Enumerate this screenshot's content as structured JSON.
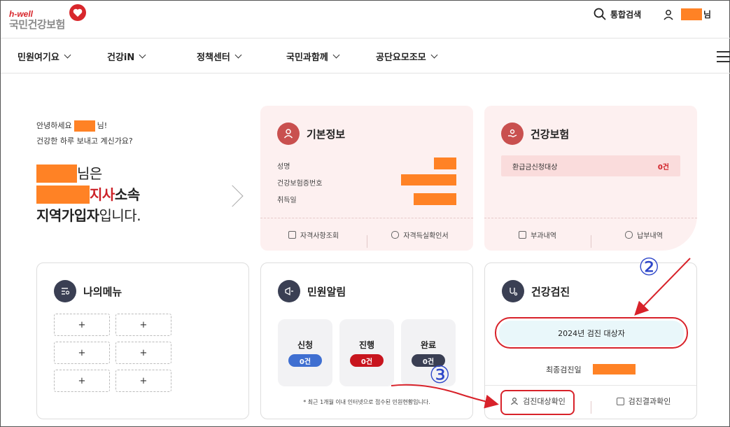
{
  "header": {
    "logo_top": "h-well",
    "logo_main": "국민건강보험",
    "search_label": "통합검색",
    "user_suffix": "님"
  },
  "nav": {
    "items": [
      "민원여기요",
      "건강iN",
      "정책센터",
      "국민과함께",
      "공단요모조모"
    ]
  },
  "greeting": {
    "line1_prefix": "안녕하세요",
    "line1_suffix": "님!",
    "line2": "건강한 하루 보내고 계신가요?",
    "big1_suffix": "님은",
    "big2_red": "지사",
    "big2_suffix": " 소속",
    "big3_bold": "지역가입자",
    "big3_suffix": "입니다."
  },
  "basic_info": {
    "title": "기본정보",
    "rows": [
      "성명",
      "건강보험증번호",
      "취득일"
    ],
    "foot_left": "자격사항조회",
    "foot_right": "자격득실확인서"
  },
  "insurance": {
    "title": "건강보험",
    "refund_label": "환급금신청대상",
    "refund_count": "0건",
    "foot_left": "부과내역",
    "foot_right": "납부내역"
  },
  "my_menu": {
    "title": "나의메뉴",
    "plus": "+"
  },
  "minwon": {
    "title": "민원알림",
    "stats": [
      {
        "label": "신청",
        "count": "0건",
        "color": "#3f6fd1"
      },
      {
        "label": "진행",
        "count": "0건",
        "color": "#c8151e"
      },
      {
        "label": "완료",
        "count": "0건",
        "color": "#3a3f53"
      }
    ],
    "note": "* 최근 1개월 이내 인터넷으로 접수된 민원현황입니다."
  },
  "checkup": {
    "title": "건강검진",
    "target_label": "2024년 검진 대상자",
    "last_label": "최종검진일",
    "foot_left": "검진대상확인",
    "foot_right": "검진결과확인"
  },
  "annotations": {
    "num2": "②",
    "num3": "③",
    "color": "#d8222a",
    "num_color": "#2d46c9"
  }
}
